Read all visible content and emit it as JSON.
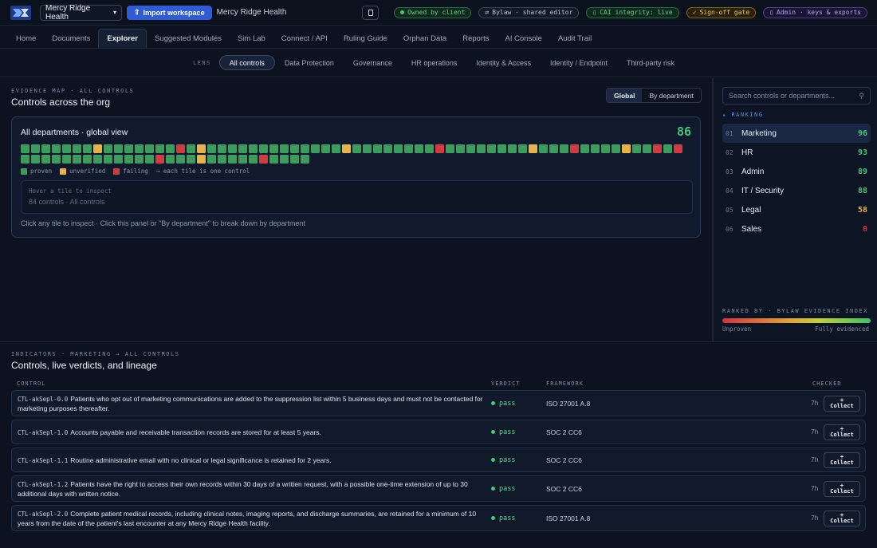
{
  "topbar": {
    "org_select": "Mercy Ridge Health",
    "import_label": "Import workspace",
    "org_name": "Mercy Ridge Health",
    "pills": [
      {
        "label": "Owned by client",
        "style": "green",
        "icon": "dot"
      },
      {
        "label": "Bylaw · shared editor",
        "style": "gray",
        "icon": "swap-icon"
      },
      {
        "label": "CAI integrity: live",
        "style": "green",
        "icon": "box-icon"
      },
      {
        "label": "Sign-off gate",
        "style": "yellow",
        "icon": "check-icon"
      },
      {
        "label": "Admin · keys & exports",
        "style": "purple",
        "icon": "key-icon"
      }
    ]
  },
  "nav": {
    "items": [
      "Home",
      "Documents",
      "Explorer",
      "Suggested Modules",
      "Sim Lab",
      "Connect / API",
      "Ruling Guide",
      "Orphan Data",
      "Reports",
      "AI Console",
      "Audit Trail"
    ],
    "active": "Explorer"
  },
  "lens": {
    "label": "LENS",
    "items": [
      "All controls",
      "Data Protection",
      "Governance",
      "HR operations",
      "Identity & Access",
      "Identity / Endpoint",
      "Third-party risk"
    ],
    "active": "All controls"
  },
  "evidence": {
    "overline": "EVIDENCE MAP · ALL CONTROLS",
    "title": "Controls across the org",
    "seg_global": "Global",
    "seg_dept": "By department",
    "card_title": "All departments · global view",
    "score": "86",
    "legend_proven": "proven",
    "legend_unverified": "unverified",
    "legend_failing": "failing",
    "legend_note": "→ each tile is one control",
    "inspect_hint": "Hover a tile to inspect",
    "inspect_meta": "84 controls · All controls",
    "footer": "Click any tile to inspect · Click this panel or \"By department\" to break down by department",
    "tiles": "gggggggugggggggrguggggggggggggguggggggggrggggggggugggrgggguggrgrgggggggggggggrgggugggggrgggg",
    "colors": {
      "g": "#3f9a5e",
      "u": "#e7b24a",
      "r": "#cf3c42"
    }
  },
  "ranking": {
    "search_placeholder": "Search controls or departments...",
    "overline": "RANKING",
    "rows": [
      {
        "num": "01",
        "name": "Marketing",
        "score": "96",
        "color": "#4cc57a"
      },
      {
        "num": "02",
        "name": "HR",
        "score": "93",
        "color": "#4cc57a"
      },
      {
        "num": "03",
        "name": "Admin",
        "score": "89",
        "color": "#4cc57a"
      },
      {
        "num": "04",
        "name": "IT / Security",
        "score": "88",
        "color": "#4cc57a"
      },
      {
        "num": "05",
        "name": "Legal",
        "score": "58",
        "color": "#e9b24a"
      },
      {
        "num": "06",
        "name": "Sales",
        "score": "0",
        "color": "#d2343d"
      }
    ],
    "ranked_by": "RANKED BY · BYLAW EVIDENCE INDEX",
    "low_label": "Unproven",
    "high_label": "Fully evidenced"
  },
  "indicators": {
    "overline": "INDICATORS · MARKETING → ALL CONTROLS",
    "title": "Controls, live verdicts, and lineage",
    "headers": {
      "control": "CONTROL",
      "verdict": "VERDICT",
      "framework": "FRAMEWORK",
      "checked": "CHECKED"
    },
    "collect_label": "Collect",
    "rows": [
      {
        "id": "CTL-akSepl-0.0",
        "text": "Patients who opt out of marketing communications are added to the suppression list within 5 business days and must not be contacted for marketing purposes thereafter.",
        "verdict": "pass",
        "framework": "ISO 27001 A.8",
        "checked": "7h"
      },
      {
        "id": "CTL-akSepl-1.0",
        "text": "Accounts payable and receivable transaction records are stored for at least 5 years.",
        "verdict": "pass",
        "framework": "SOC 2 CC6",
        "checked": "7h"
      },
      {
        "id": "CTL-akSepl-1.1",
        "text": "Routine administrative email with no clinical or legal significance is retained for 2 years.",
        "verdict": "pass",
        "framework": "SOC 2 CC6",
        "checked": "7h"
      },
      {
        "id": "CTL-akSepl-1.2",
        "text": "Patients have the right to access their own records within 30 days of a written request, with a possible one-time extension of up to 30 additional days with written notice.",
        "verdict": "pass",
        "framework": "SOC 2 CC6",
        "checked": "7h"
      },
      {
        "id": "CTL-akSepl-2.0",
        "text": "Complete patient medical records, including clinical notes, imaging reports, and discharge summaries, are retained for a minimum of 10 years from the date of the patient's last encounter at any Mercy Ridge Health facility.",
        "verdict": "pass",
        "framework": "ISO 27001 A.8",
        "checked": "7h"
      }
    ]
  }
}
